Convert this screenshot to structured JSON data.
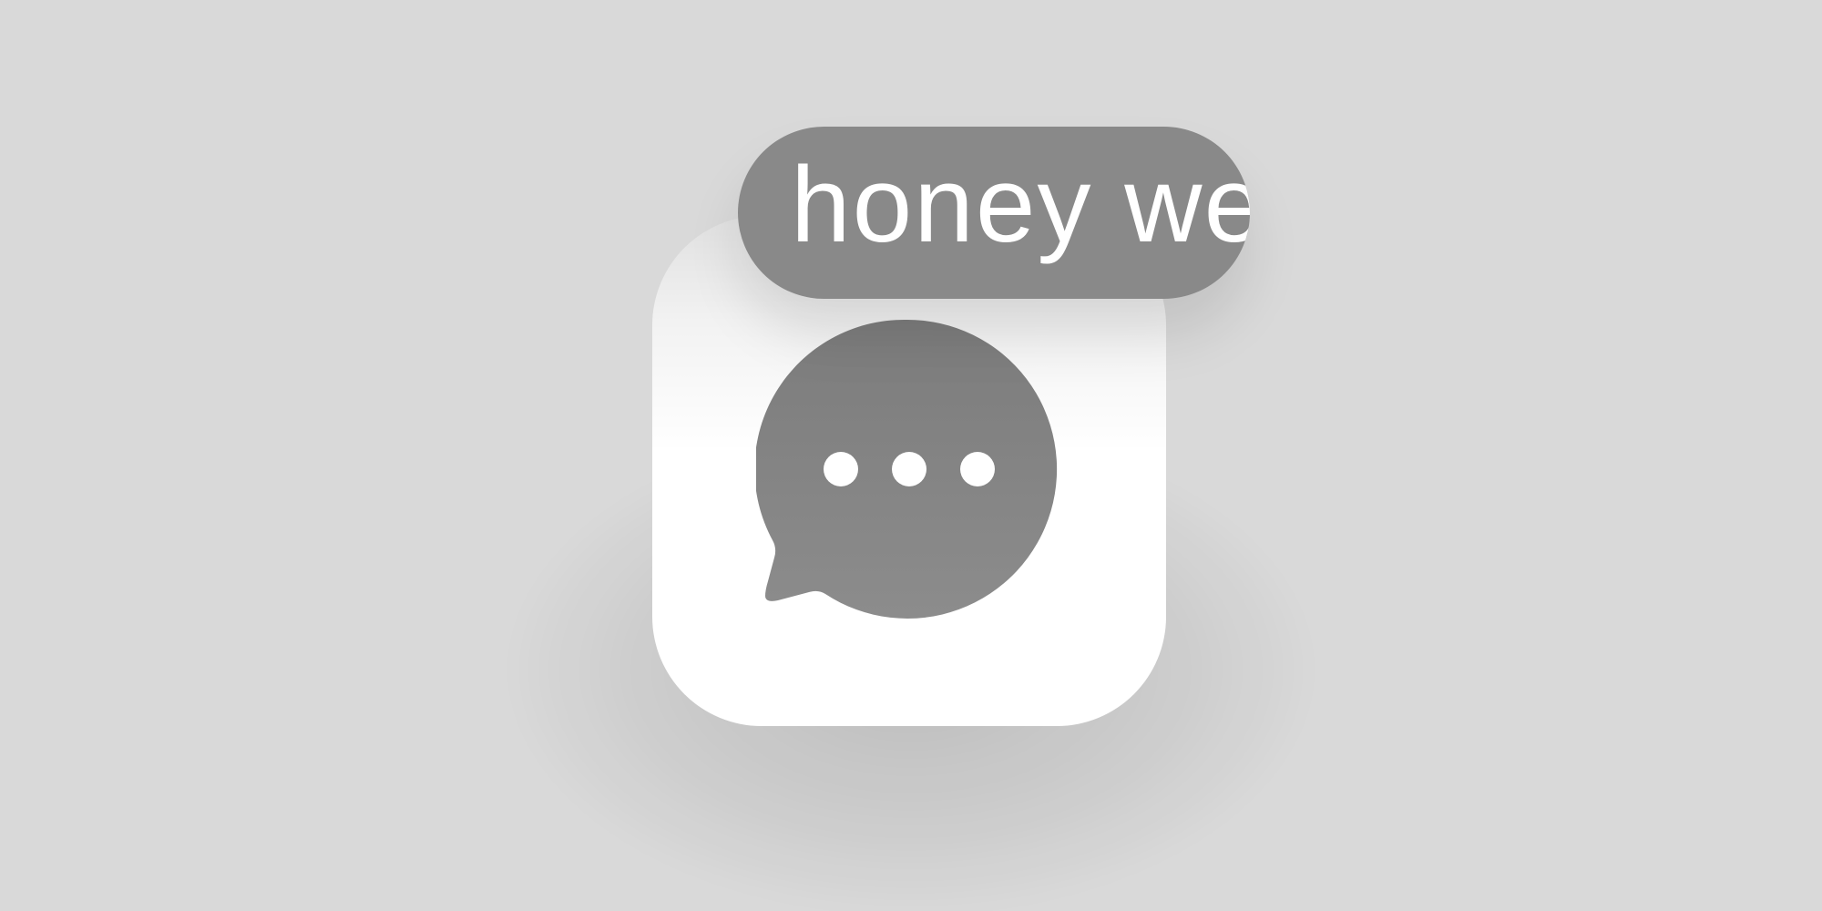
{
  "floating_label": {
    "text": "honey we"
  },
  "app_icon": {
    "icon": "chat-bubble-ellipsis-icon",
    "tile_color": "#ffffff",
    "glyph_color": "#8a8a8a"
  },
  "colors": {
    "background": "#d9d9d9",
    "pill": "#898989",
    "pill_text": "#ffffff"
  }
}
